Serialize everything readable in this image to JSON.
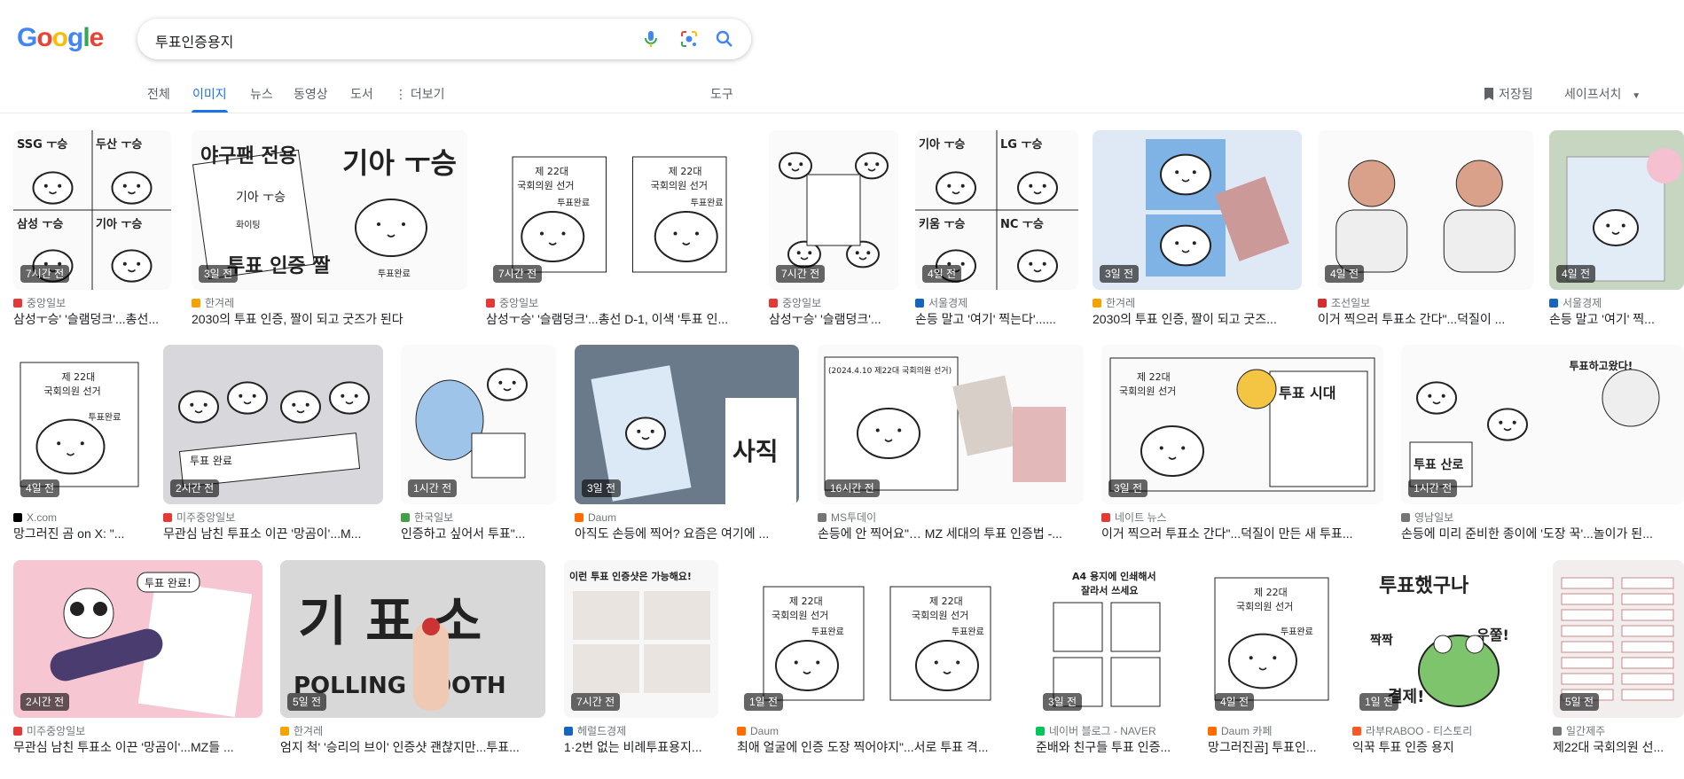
{
  "logo": {
    "letters": [
      "G",
      "o",
      "o",
      "g",
      "l",
      "e"
    ],
    "colors": [
      "#4285f4",
      "#ea4335",
      "#fbbc05",
      "#4285f4",
      "#34a853",
      "#ea4335"
    ]
  },
  "search": {
    "query": "투표인증용지"
  },
  "icons": {
    "mic": "mic-icon",
    "lens": "lens-icon",
    "search": "search-icon"
  },
  "tabs": [
    {
      "label": "전체",
      "active": false
    },
    {
      "label": "이미지",
      "active": true
    },
    {
      "label": "뉴스",
      "active": false
    },
    {
      "label": "동영상",
      "active": false
    },
    {
      "label": "도서",
      "active": false
    },
    {
      "label": "더보기",
      "active": false
    }
  ],
  "tools_label": "도구",
  "saved_label": "저장됨",
  "safesearch_label": "세이프서치",
  "colors": {
    "accent": "#1a73e8",
    "text": "#202124",
    "muted": "#70757a"
  },
  "results": [
    {
      "age": "7시간 전",
      "source": "중앙일보",
      "title": "삼성ㅜ승' '슬램덩크'...총선...",
      "fav": "#e53935"
    },
    {
      "age": "3일 전",
      "source": "한겨레",
      "title": "2030의 투표 인증, 짤이 되고 굿즈가 된다",
      "fav": "#f4a300"
    },
    {
      "age": "7시간 전",
      "source": "중앙일보",
      "title": "삼성ㅜ승' '슬램덩크'...총선 D-1, 이색 '투표 인...",
      "fav": "#e53935"
    },
    {
      "age": "7시간 전",
      "source": "중앙일보",
      "title": "삼성ㅜ승' '슬램덩크'...",
      "fav": "#e53935"
    },
    {
      "age": "4일 전",
      "source": "서울경제",
      "title": "손등 말고 '여기' 찍는다'......",
      "fav": "#1565c0"
    },
    {
      "age": "3일 전",
      "source": "한겨레",
      "title": "2030의 투표 인증, 짤이 되고 굿즈...",
      "fav": "#f4a300"
    },
    {
      "age": "4일 전",
      "source": "조선일보",
      "title": "이거 찍으러 투표소 간다\"...덕질이 ...",
      "fav": "#d32f2f"
    },
    {
      "age": "4일 전",
      "source": "서울경제",
      "title": "손등 말고 '여기' 찍...",
      "fav": "#1565c0"
    },
    {
      "age": "4일 전",
      "source": "X.com",
      "title": "망그러진 곰 on X: \"...",
      "fav": "#000000"
    },
    {
      "age": "2시간 전",
      "source": "미주중앙일보",
      "title": "무관심 남친 투표소 이끈 '망곰이'...M...",
      "fav": "#e53935"
    },
    {
      "age": "1시간 전",
      "source": "한국일보",
      "title": "인증하고 싶어서 투표\"...",
      "fav": "#43a047"
    },
    {
      "age": "3일 전",
      "source": "Daum",
      "title": "아직도 손등에 찍어? 요즘은 여기에 ...",
      "fav": "#ff6d00"
    },
    {
      "age": "16시간 전",
      "source": "MS투데이",
      "title": "손등에 안 찍어요\"… MZ 세대의 투표 인증법 -...",
      "fav": "#757575"
    },
    {
      "age": "3일 전",
      "source": "네이트 뉴스",
      "title": "이거 찍으러 투표소 간다\"...덕질이 만든 새 투표...",
      "fav": "#e53935"
    },
    {
      "age": "1시간 전",
      "source": "영남일보",
      "title": "손등에 미리 준비한 종이에 '도장 꾹'...놀이가 된...",
      "fav": "#757575"
    },
    {
      "age": "2시간 전",
      "source": "미주중앙일보",
      "title": "무관심 남친 투표소 이끈 '망곰이'...MZ들 ...",
      "fav": "#e53935"
    },
    {
      "age": "5일 전",
      "source": "한겨레",
      "title": "엄지 척' '승리의 브이' 인증샷 괜찮지만...투표...",
      "fav": "#f4a300"
    },
    {
      "age": "7시간 전",
      "source": "헤럴드경제",
      "title": "1·2번 없는 비례투표용지...",
      "fav": "#1565c0"
    },
    {
      "age": "1일 전",
      "source": "Daum",
      "title": "최애 얼굴에 인증 도장 찍어야지\"...서로 투표 격...",
      "fav": "#ff6d00"
    },
    {
      "age": "3일 전",
      "source": "네이버 블로그 - NAVER",
      "title": "준배와 친구들 투표 인증...",
      "fav": "#03c75a"
    },
    {
      "age": "4일 전",
      "source": "Daum 카페",
      "title": "망그러진곰] 투표인...",
      "fav": "#ff6d00"
    },
    {
      "age": "1일 전",
      "source": "라부RABOO - 티스토리",
      "title": "익꾹 투표 인증 용지",
      "fav": "#ff5722"
    },
    {
      "age": "5일 전",
      "source": "일간제주",
      "title": "제22대 국회의원 선...",
      "fav": "#757575"
    }
  ],
  "thumb_text": {
    "t0": [
      "SSG ㅜ승",
      "두산 ㅜ승",
      "삼성 ㅜ승",
      "기아 ㅜ승"
    ],
    "t1": [
      "야구팬 전용",
      "기아 ㅜ승",
      "화이팅",
      "투표 인증 짤",
      "기아 ㅜ승",
      "투표완료"
    ],
    "t2": [
      "제 22대",
      "국회의원 선거",
      "투표완료"
    ],
    "t4": [
      "기아 ㅜ승",
      "LG ㅜ승",
      "키움 ㅜ승",
      "NC ㅜ승"
    ],
    "t8": [
      "제 22대",
      "국회의원 선거",
      "투표완료"
    ],
    "t9": [
      "투표 완료"
    ],
    "t11": [
      "사직"
    ],
    "t12": [
      "(2024.4.10 제22대 국회의원 선거)"
    ],
    "t13": [
      "제 22대",
      "국회의원 선거",
      "투표 시대"
    ],
    "t14": [
      "투표하고왔다!",
      "투표 산로"
    ],
    "t15": [
      "투표 완료!"
    ],
    "t16": [
      "기 표 소",
      "POLLING BOOTH"
    ],
    "t17": [
      "이런 투표 인증샷은 가능해요!"
    ],
    "t18": [
      "제 22대",
      "국회의원 선거",
      "투표완료"
    ],
    "t19": [
      "A4 용지에 인쇄해서",
      "잘라서 쓰세요"
    ],
    "t20": [
      "제 22대",
      "국회의원 선거",
      "투표완료"
    ],
    "t21": [
      "투표했구나",
      "우쭐!",
      "짝짝",
      "결제!"
    ]
  }
}
